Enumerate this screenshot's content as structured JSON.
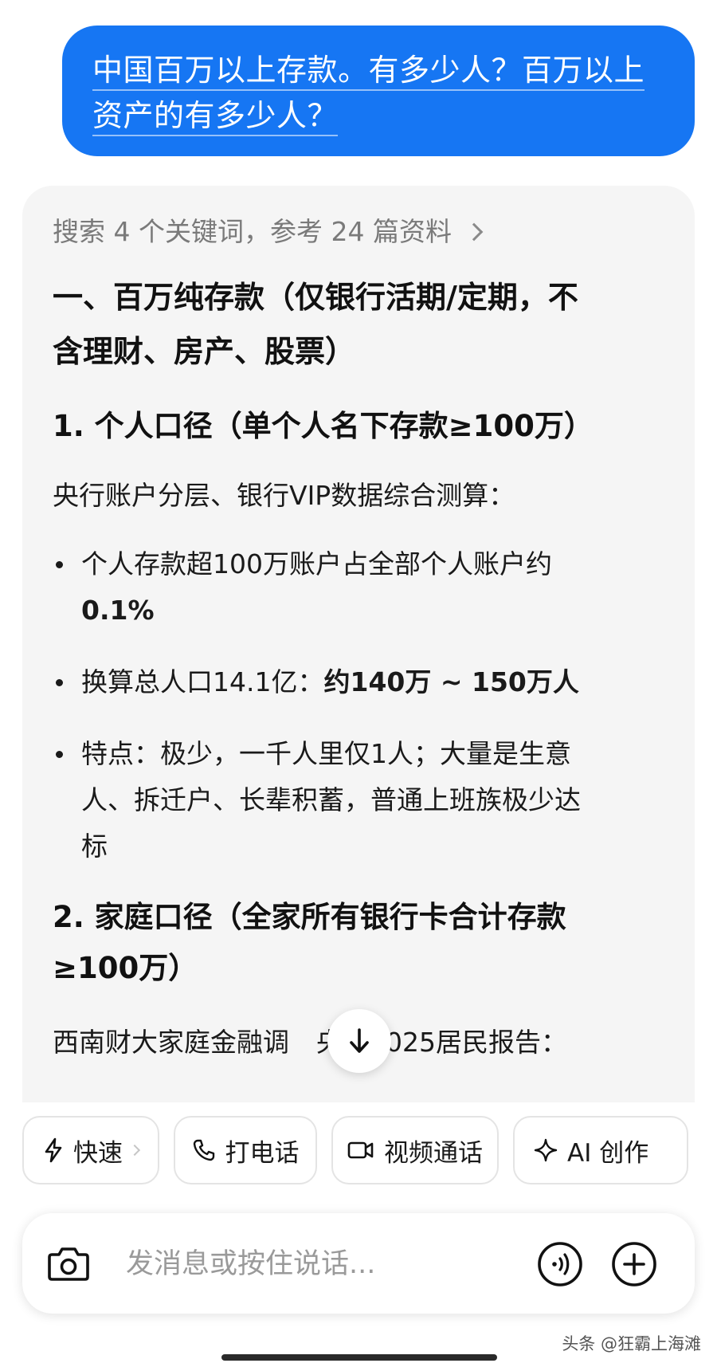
{
  "user_message": {
    "line1": "中国百万以上存款。有多少人？百万以上",
    "line2": "资产的有多少人？"
  },
  "answer": {
    "search_summary": "搜索 4 个关键词，参考 24 篇资料",
    "heading1_line1": "一、百万纯存款（仅银行活期/定期，不",
    "heading1_line2": "含理财、房产、股票）",
    "heading2": "1. 个人口径（单个人名下存款≥100万）",
    "intro": "央行账户分层、银行VIP数据综合测算：",
    "bullets": [
      {
        "line1": "个人存款超100万账户占全部个人账户约",
        "line2_bold": "0.1%"
      },
      {
        "text": "换算总人口14.1亿：",
        "bold": "约140万 ~ 150万人"
      },
      {
        "line1": "特点：极少，一千人里仅1人；大量是生意",
        "line2": "人、拆迁户、长辈积蓄，普通上班族极少达",
        "line3": "标"
      }
    ],
    "heading3_line1": "2. 家庭口径（全家所有银行卡合计存款",
    "heading3_line2": "≥100万）",
    "partial_line_left": "西南财大家庭金融调",
    "partial_line_right": "央行2025居民报告："
  },
  "actions": [
    {
      "label": "快速",
      "icon": "lightning-icon"
    },
    {
      "label": "打电话",
      "icon": "phone-icon"
    },
    {
      "label": "视频通话",
      "icon": "video-icon"
    },
    {
      "label": "AI 创作",
      "icon": "sparkle-icon"
    }
  ],
  "input": {
    "placeholder": "发消息或按住说话..."
  },
  "watermark": "头条 @狂霸上海滩",
  "colors": {
    "user_bubble": "#1676f3",
    "card_bg": "#f5f5f5",
    "text": "#1a1a1a",
    "muted": "#7a7a7a"
  }
}
